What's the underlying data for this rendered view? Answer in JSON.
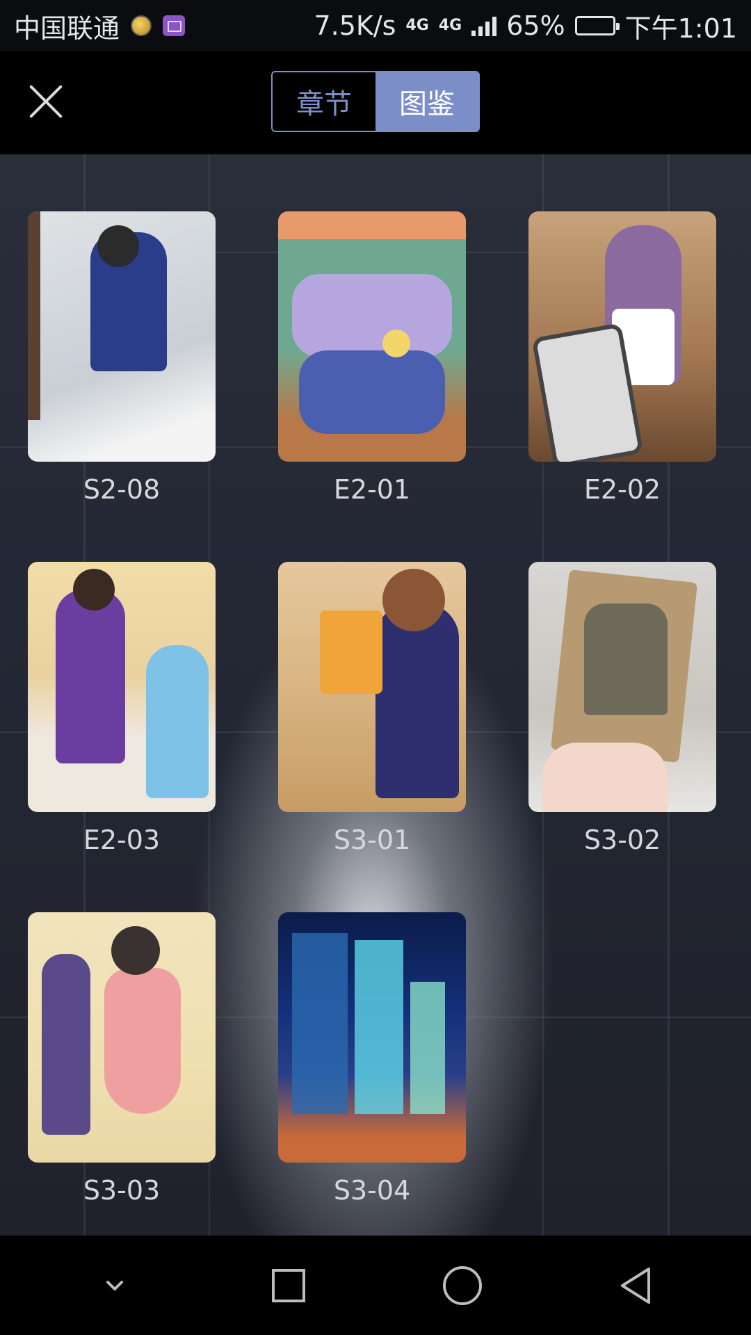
{
  "status_bar": {
    "carrier": "中国联通",
    "speed": "7.5K/s",
    "network_1": "4G",
    "network_2": "4G",
    "battery_percent": "65%",
    "battery_level": 0.65,
    "time": "下午1:01"
  },
  "header": {
    "tabs": [
      {
        "label": "章节",
        "active": false
      },
      {
        "label": "图鉴",
        "active": true
      }
    ]
  },
  "gallery": {
    "items": [
      {
        "label": "S2-08"
      },
      {
        "label": "E2-01"
      },
      {
        "label": "E2-02"
      },
      {
        "label": "E2-03"
      },
      {
        "label": "S3-01"
      },
      {
        "label": "S3-02"
      },
      {
        "label": "S3-03"
      },
      {
        "label": "S3-04"
      }
    ]
  },
  "colors": {
    "accent": "#7b8ec7",
    "background": "#000000",
    "label_text": "#d8d8dc"
  }
}
